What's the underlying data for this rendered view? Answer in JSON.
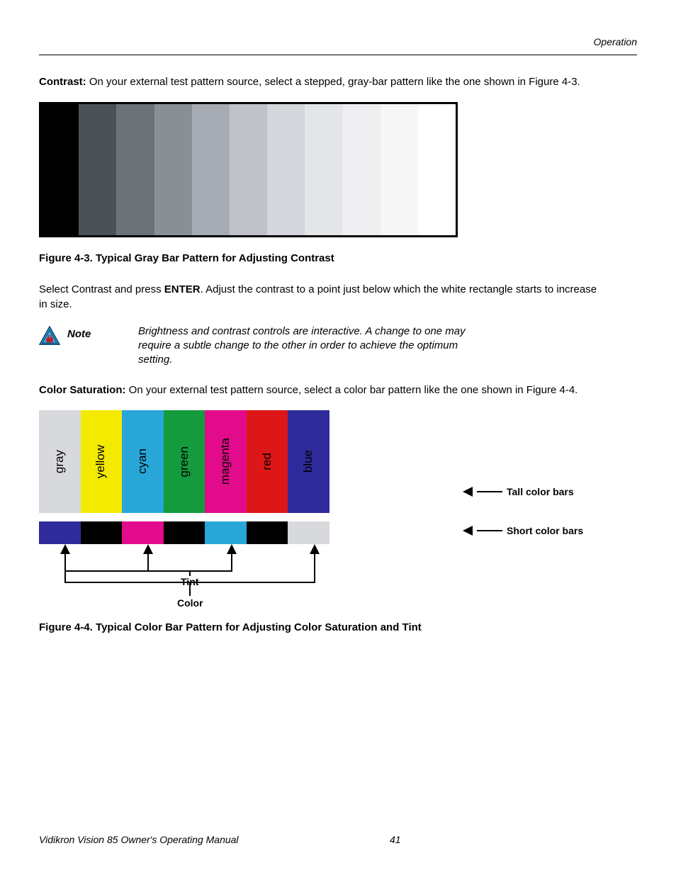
{
  "header": {
    "section": "Operation"
  },
  "contrast": {
    "label": "Contrast:",
    "text": " On your external test pattern source, select a stepped, gray-bar pattern like the one shown in Figure 4-3."
  },
  "gray_bars": [
    "#000000",
    "#4a5258",
    "#6b7278",
    "#8a8f96",
    "#a7abb3",
    "#bfc2c9",
    "#d4d6db",
    "#e4e5e8",
    "#efeff1",
    "#f7f7f8",
    "#ffffff"
  ],
  "caption1": "Figure 4-3. Typical Gray Bar Pattern for Adjusting Contrast",
  "select_contrast": {
    "pre": "Select Contrast and press ",
    "bold": "ENTER",
    "post": ". Adjust the contrast to a point just below which the white rectangle starts to increase in size."
  },
  "note": {
    "label": "Note",
    "text": "Brightness and contrast controls are interactive. A change to one may require a subtle change to the other in order to achieve the optimum setting."
  },
  "saturation": {
    "label": "Color Saturation:",
    "text": " On your external test pattern source, select a color bar pattern like the one shown in Figure 4-4."
  },
  "tall_bars": [
    {
      "label": "gray",
      "color": "#d8d9dc"
    },
    {
      "label": "yellow",
      "color": "#f4ea00"
    },
    {
      "label": "cyan",
      "color": "#29a6d8"
    },
    {
      "label": "green",
      "color": "#149b3e"
    },
    {
      "label": "magenta",
      "color": "#e20b8c"
    },
    {
      "label": "red",
      "color": "#dd1718"
    },
    {
      "label": "blue",
      "color": "#2f2b9c"
    }
  ],
  "short_bars": [
    "#2f2b9c",
    "#000000",
    "#e20b8c",
    "#000000",
    "#29a6d8",
    "#000000",
    "#d8d9dc"
  ],
  "side": {
    "tall": "Tall color bars",
    "short": "Short color bars"
  },
  "under": {
    "tint": "Tint",
    "color": "Color"
  },
  "caption2": "Figure 4-4. Typical Color Bar Pattern for Adjusting Color Saturation and Tint",
  "footer": {
    "title": "Vidikron Vision 85 Owner's Operating Manual",
    "page": "41"
  }
}
